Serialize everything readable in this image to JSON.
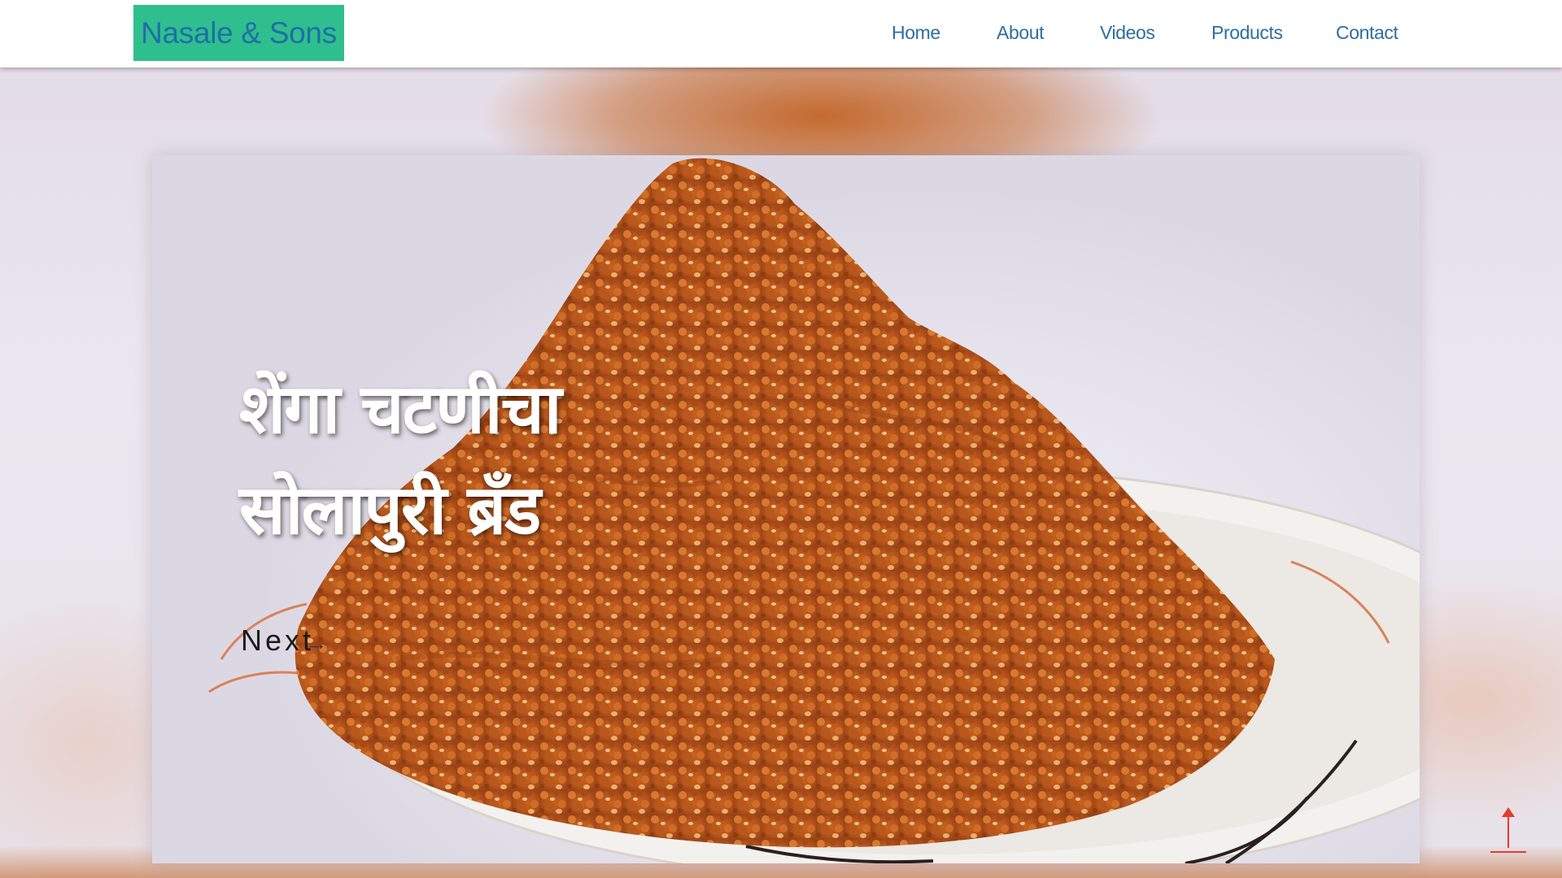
{
  "header": {
    "logo": "Nasale & Sons",
    "nav": [
      "Home",
      "About",
      "Videos",
      "Products",
      "Contact"
    ]
  },
  "hero": {
    "title_line1": "शेंगा चटणीचा",
    "title_line2": "सोलापुरी ब्रँड",
    "next_label": "Next",
    "next_icon": "arrow-right-icon"
  },
  "scroll_top": {
    "icon": "arrow-up-icon"
  },
  "colors": {
    "logo_bg": "#2fbf8e",
    "logo_text": "#1f6fa6",
    "nav_text": "#2c6ea2",
    "accent_red": "#e23b2e"
  }
}
